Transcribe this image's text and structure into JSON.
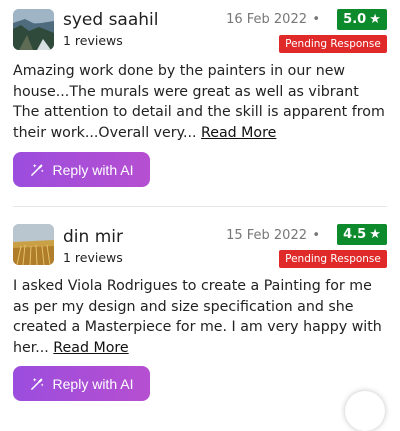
{
  "reviews": [
    {
      "name": "syed saahil",
      "review_count": "1 reviews",
      "date": "16 Feb 2022",
      "separator": "•",
      "rating": "5.0",
      "star": "★",
      "status": "Pending Response",
      "text": "Amazing work done by the painters in our new house...The murals were great as well as vibrant The attention to detail and the skill is apparent from their work...Overall very... ",
      "read_more": "Read More",
      "reply_label": "Reply with AI",
      "avatar": "seaside-cliff-photo"
    },
    {
      "name": "din mir",
      "review_count": "1 reviews",
      "date": "15 Feb 2022",
      "separator": "•",
      "rating": "4.5",
      "star": "★",
      "status": "Pending Response",
      "text": "I asked Viola Rodrigues to create a Painting for me as per my design and size specification and she created a Masterpiece for me. I am very happy with her... ",
      "read_more": "Read More",
      "reply_label": "Reply with AI",
      "avatar": "wheat-field-photo"
    }
  ],
  "colors": {
    "rating_green": "#0c8a2c",
    "pending_red": "#e02a2a",
    "reply_gradient_start": "#9b4ddd",
    "reply_gradient_end": "#b64fd1"
  },
  "icons": {
    "reply": "magic-wand-icon",
    "fab": "floating-action-button"
  }
}
